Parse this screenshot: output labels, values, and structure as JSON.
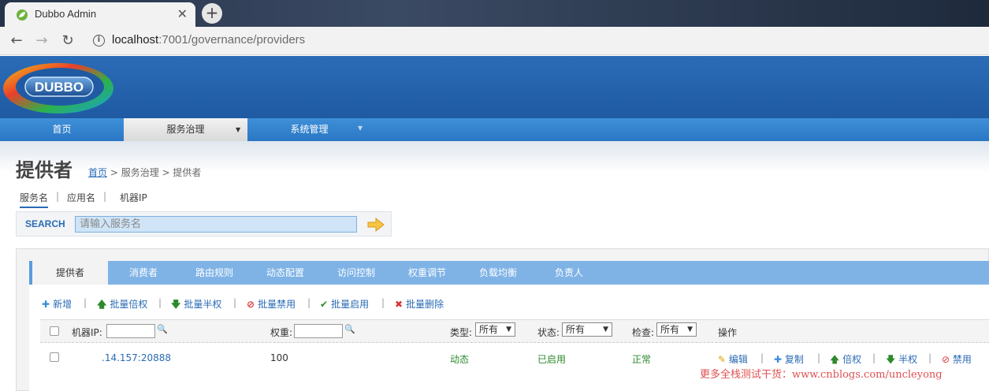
{
  "browser": {
    "tab_title": "Dubbo Admin",
    "url_host": "localhost",
    "url_path": ":7001/governance/providers"
  },
  "app": {
    "logo_text": "DUBBO",
    "nav": [
      {
        "label": "首页"
      },
      {
        "label": "服务治理"
      },
      {
        "label": "系统管理"
      }
    ]
  },
  "page": {
    "title": "提供者",
    "breadcrumb": {
      "home": "首页",
      "rest": "> 服务治理 > 提供者"
    },
    "subtabs": [
      "服务名",
      "应用名",
      "机器IP"
    ],
    "search": {
      "label": "SEARCH",
      "placeholder": "请输入服务名"
    }
  },
  "panel": {
    "tabs": [
      "提供者",
      "消费者",
      "路由规则",
      "动态配置",
      "访问控制",
      "权重调节",
      "负载均衡",
      "负责人"
    ],
    "actions": [
      {
        "icon": "plus-icon",
        "label": "新增"
      },
      {
        "icon": "arrow-up-icon",
        "label": "批量倍权"
      },
      {
        "icon": "arrow-down-icon",
        "label": "批量半权"
      },
      {
        "icon": "ban-icon",
        "label": "批量禁用"
      },
      {
        "icon": "check-icon",
        "label": "批量启用"
      },
      {
        "icon": "cross-icon",
        "label": "批量删除"
      }
    ],
    "header": {
      "ip": "机器IP:",
      "weight": "权重:",
      "type": "类型:",
      "type_value": "所有",
      "status": "状态:",
      "status_value": "所有",
      "check": "检查:",
      "check_value": "所有",
      "ops": "操作"
    },
    "rows": [
      {
        "ip": ".14.157:20888",
        "weight": "100",
        "type": "动态",
        "status": "已启用",
        "check": "正常",
        "ops": [
          "编辑",
          "复制",
          "倍权",
          "半权",
          "禁用"
        ]
      }
    ]
  },
  "watermark": "更多全栈测试干货：www.cnblogs.com/uncleyong",
  "colors": {
    "header_blue": "#1f5aa3",
    "nav_blue": "#2a77c3",
    "link": "#2a6bb5",
    "tab_bar": "#7fb3e6"
  }
}
